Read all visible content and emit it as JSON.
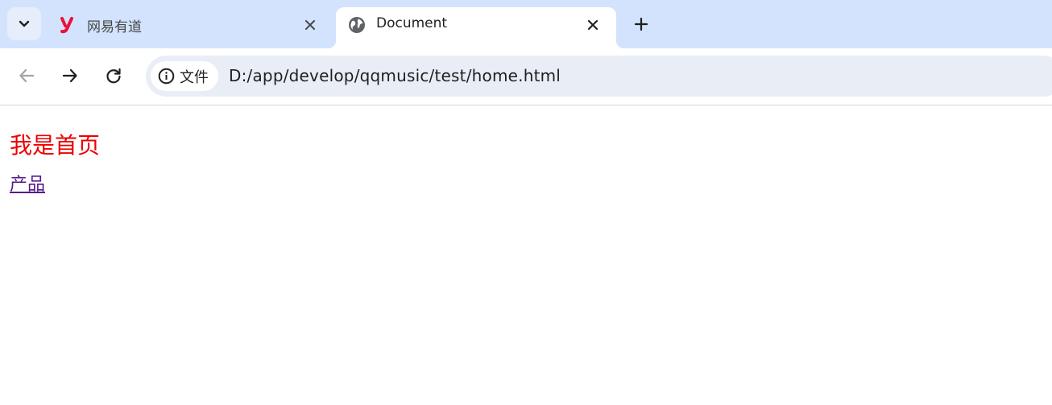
{
  "browser": {
    "tabs": [
      {
        "title": "网易有道",
        "favicon": "youdao-logo-icon",
        "active": false
      },
      {
        "title": "Document",
        "favicon": "globe-icon",
        "active": true
      }
    ],
    "address_bar": {
      "site_chip_label": "文件",
      "url": "D:/app/develop/qqmusic/test/home.html"
    }
  },
  "page": {
    "heading": "我是首页",
    "link": "产品",
    "colors": {
      "heading": "#ee0000",
      "link_visited": "#551a8b",
      "tabstrip": "#d3e3fd"
    }
  }
}
